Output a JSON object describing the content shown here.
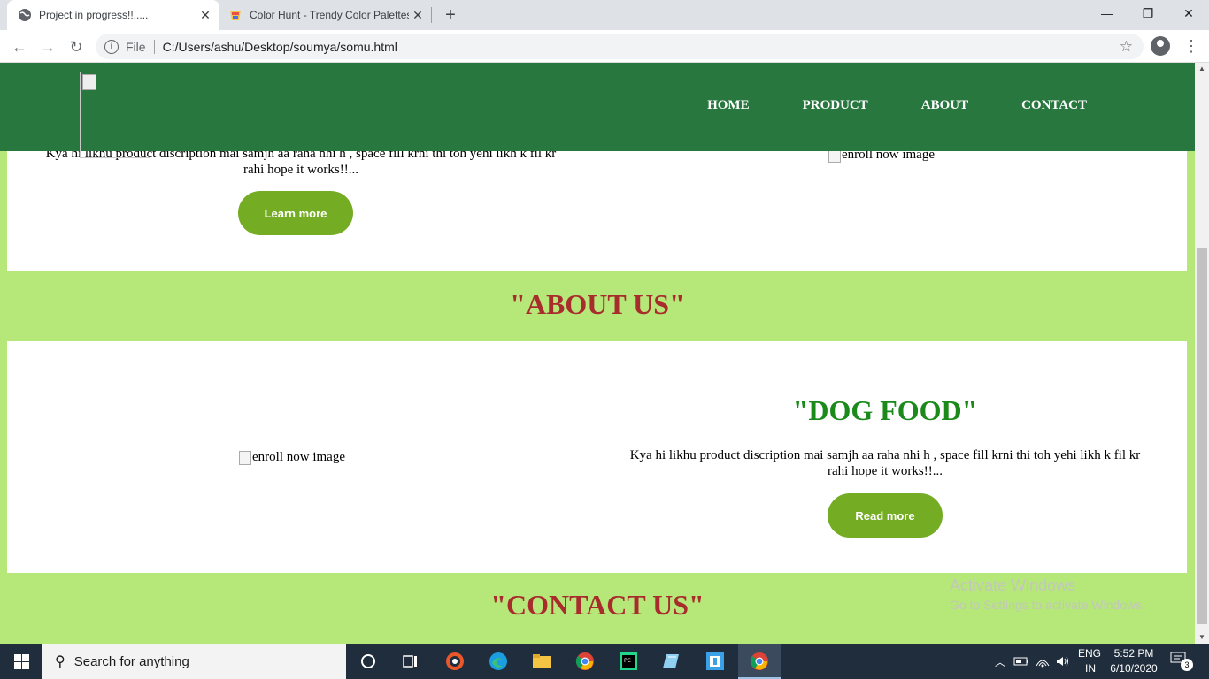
{
  "browser": {
    "tabs": [
      {
        "title": "Project in progress!!.....",
        "active": true,
        "favicon": "globe-icon"
      },
      {
        "title": "Color Hunt - Trendy Color Palettes",
        "active": false,
        "favicon": "color-hunt-icon"
      }
    ],
    "address": {
      "scheme_label": "File",
      "url": "C:/Users/ashu/Desktop/soumya/somu.html"
    },
    "icons": {
      "back": "←",
      "forward": "→",
      "reload": "↻",
      "info": "i",
      "star": "☆",
      "menu": "⋮",
      "new_tab": "+",
      "close_tab": "✕",
      "minimize": "—",
      "maximize": "❐",
      "close_window": "✕"
    }
  },
  "site": {
    "nav": [
      "HOME",
      "PRODUCT",
      "ABOUT",
      "CONTACT"
    ],
    "card1": {
      "description": "Kya hi likhu product discription mai samjh aa raha nhi h , space fill krni thi toh yehi likh k fil kr rahi hope it works!!...",
      "button": "Learn more",
      "image_alt": "enroll now image"
    },
    "about_title": "\"ABOUT US\"",
    "card2": {
      "title": "\"DOG FOOD\"",
      "description": "Kya hi likhu product discription mai samjh aa raha nhi h , space fill krni thi toh yehi likh k fil kr rahi hope it works!!...",
      "button": "Read more",
      "image_alt": "enroll now image"
    },
    "contact_title": "\"CONTACT US\"",
    "colors": {
      "nav_bg": "#27773e",
      "page_bg": "#b6e879",
      "button_bg": "#74ac23",
      "section_title": "#a82c2c",
      "card_title": "#1b8a1b"
    }
  },
  "watermark": {
    "line1": "Activate Windows",
    "line2": "Go to Settings to activate Windows."
  },
  "taskbar": {
    "search_placeholder": "Search for anything",
    "lang_line1": "ENG",
    "lang_line2": "IN",
    "time": "5:52 PM",
    "date": "6/10/2020",
    "notification_count": "3",
    "pinned": [
      "cortana-icon",
      "task-view-icon",
      "media-player-icon",
      "edge-icon",
      "file-explorer-icon",
      "chrome-icon",
      "pycharm-icon",
      "notepad-icon",
      "app-icon",
      "chrome-icon"
    ]
  }
}
